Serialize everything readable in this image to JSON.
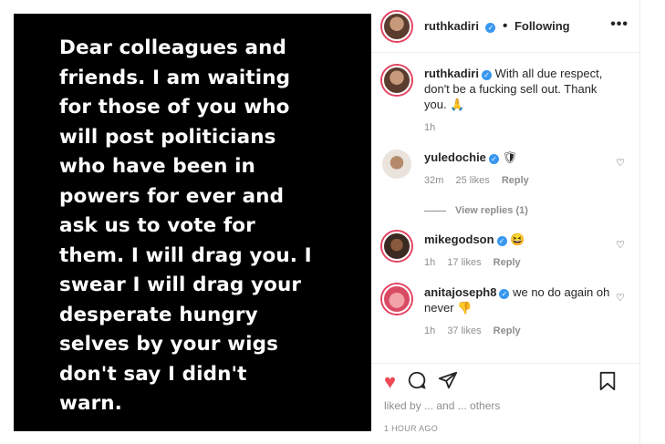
{
  "post": {
    "text": "Dear colleagues and\nfriends. I am waiting\nfor those of you who\nwill post politicians\nwho have been in\npowers for ever and\nask us to vote for\nthem.  I will drag you. I\nswear I will drag your\ndesperate hungry\nselves by your wigs\ndon't say I didn't\nwarn."
  },
  "header": {
    "username": "ruthkadiri",
    "dot": "•",
    "following": "Following",
    "more": "•••"
  },
  "caption": {
    "username": "ruthkadiri",
    "text": "With all due respect, don't be a fucking sell out. Thank you. 🙏",
    "time": "1h"
  },
  "comments": [
    {
      "username": "yuledochie",
      "text": "🛡",
      "time": "32m",
      "likes": "25 likes",
      "reply": "Reply"
    },
    {
      "username": "mikegodson",
      "text": "😆",
      "time": "1h",
      "likes": "17 likes",
      "reply": "Reply"
    },
    {
      "username": "anitajoseph8",
      "text": "we no do again oh never 👎",
      "time": "1h",
      "likes": "37 likes",
      "reply": "Reply"
    }
  ],
  "view_replies": "View replies (1)",
  "liked_by": "liked by ... and ... others",
  "time_ago": "1 HOUR AGO",
  "icons": {
    "heart": "heart-icon",
    "comment": "comment-icon",
    "share": "share-icon",
    "bookmark": "bookmark-icon"
  }
}
